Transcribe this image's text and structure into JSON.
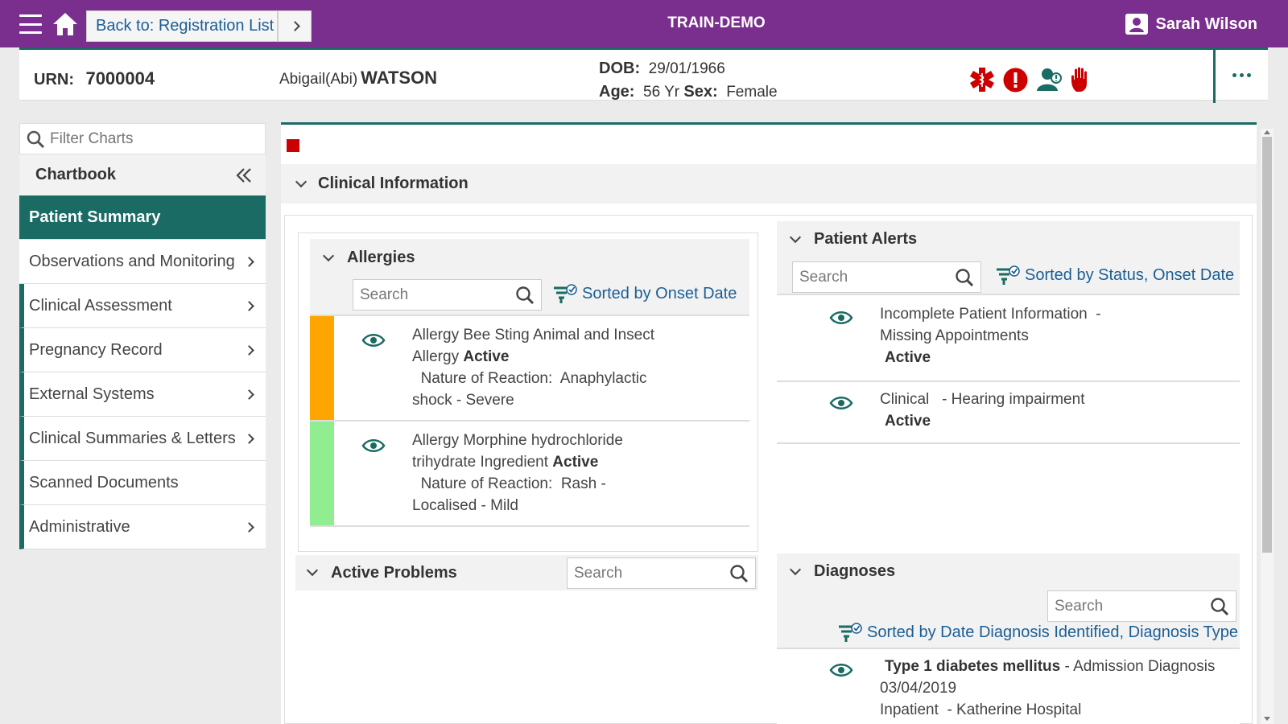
{
  "topbar": {
    "back_label": "Back to: Registration List",
    "app_title": "TRAIN-DEMO",
    "user_name": "Sarah Wilson"
  },
  "patient": {
    "urn_label": "URN:",
    "urn": "7000004",
    "given_name": "Abigail(Abi)",
    "family_name": "WATSON",
    "dob_label": "DOB:",
    "dob": "29/01/1966",
    "age_label": "Age:",
    "age": "56 Yr",
    "sex_label": "Sex:",
    "sex": "Female"
  },
  "sidebar": {
    "filter_placeholder": "Filter Charts",
    "chartbook_label": "Chartbook",
    "items": [
      {
        "label": "Patient Summary"
      },
      {
        "label": "Observations and Monitoring"
      },
      {
        "label": "Clinical Assessment"
      },
      {
        "label": "Pregnancy Record"
      },
      {
        "label": "External Systems"
      },
      {
        "label": "Clinical Summaries & Letters"
      },
      {
        "label": "Scanned Documents"
      },
      {
        "label": "Administrative"
      }
    ]
  },
  "main": {
    "section_title": "Clinical Information",
    "search_placeholder": "Search",
    "allergies": {
      "title": "Allergies",
      "sorted_label": "Sorted by Onset Date",
      "rows": [
        {
          "bar_color": "#ffa500",
          "line1": "Allergy     Bee Sting   Animal and Insect Allergy",
          "status": "Active",
          "line2": "  Nature of Reaction:  Anaphylactic shock - Severe"
        },
        {
          "bar_color": "#90ee90",
          "line1": "Allergy     Morphine hydrochloride trihydrate   Ingredient",
          "status": "Active",
          "line2": "  Nature of Reaction:  Rash - Localised - Mild"
        }
      ]
    },
    "problems": {
      "title": "Active Problems"
    },
    "alerts": {
      "title": "Patient Alerts",
      "sorted_label": "Sorted by Status, Onset Date",
      "rows": [
        {
          "text": "Incomplete Patient Information  - Missing Appointments",
          "status": "Active"
        },
        {
          "text": "Clinical   - Hearing impairment",
          "status": "Active"
        }
      ]
    },
    "diagnoses": {
      "title": "Diagnoses",
      "sorted_label": "Sorted by Date Diagnosis Identified, Diagnosis Type",
      "rows": [
        {
          "name": "Type 1 diabetes mellitus",
          "rest": " - Admission Diagnosis   03/04/2019",
          "line3": "Inpatient  - Katherine Hospital"
        }
      ]
    }
  },
  "colors": {
    "brand": "#7a2e8e",
    "teal": "#1a6b63",
    "link": "#1b5e94",
    "alert_red": "#cc0000"
  },
  "icons": [
    "menu-icon",
    "home-icon",
    "chevron-right-icon",
    "user-icon",
    "medical-star-icon",
    "exclamation-icon",
    "person-alert-icon",
    "hand-stop-icon",
    "more-icon",
    "search-icon",
    "chevron-down-icon",
    "double-chevron-left-icon",
    "eye-icon",
    "sort-filter-icon"
  ]
}
